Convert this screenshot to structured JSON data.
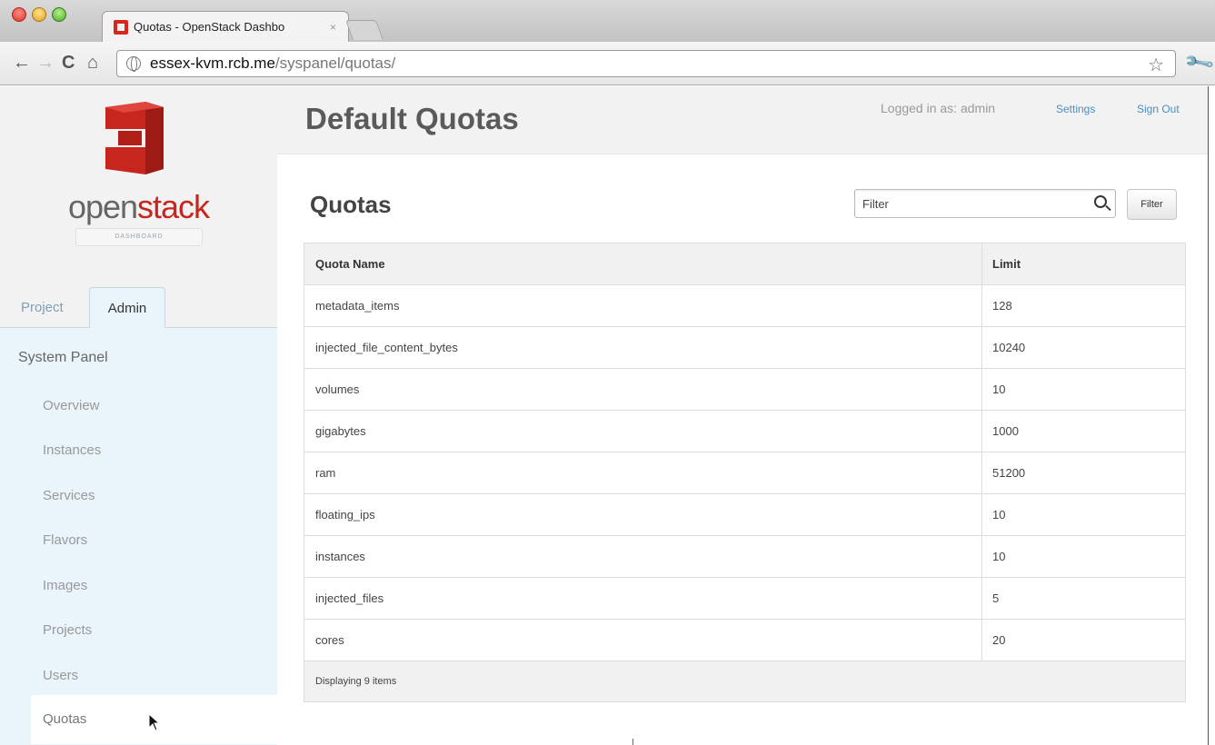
{
  "browser": {
    "tab_title": "Quotas - OpenStack Dashbo",
    "tab_close": "×",
    "url_host": "essex-kvm.rcb.me",
    "url_path": "/syspanel/quotas/",
    "icons": [
      "back-icon",
      "forward-icon",
      "reload-icon",
      "home-icon",
      "globe-icon",
      "star-icon",
      "wrench-icon"
    ]
  },
  "logo": {
    "text_open": "open",
    "text_stack": "stack",
    "subtitle": "DASHBOARD",
    "brand_color": "#c7261e"
  },
  "sidebar": {
    "tabs": [
      {
        "label": "Project",
        "active": false
      },
      {
        "label": "Admin",
        "active": true
      }
    ],
    "panel_title": "System Panel",
    "items": [
      {
        "label": "Overview",
        "active": false
      },
      {
        "label": "Instances",
        "active": false
      },
      {
        "label": "Services",
        "active": false
      },
      {
        "label": "Flavors",
        "active": false
      },
      {
        "label": "Images",
        "active": false
      },
      {
        "label": "Projects",
        "active": false
      },
      {
        "label": "Users",
        "active": false
      },
      {
        "label": "Quotas",
        "active": true
      }
    ]
  },
  "header": {
    "title": "Default Quotas",
    "logged_in": "Logged in as: admin",
    "settings": "Settings",
    "sign_out": "Sign Out",
    "link_color": "#4a8fc1"
  },
  "main": {
    "section_title": "Quotas",
    "filter_placeholder": "Filter",
    "filter_button": "Filter"
  },
  "table": {
    "columns": [
      "Quota Name",
      "Limit"
    ],
    "rows": [
      {
        "name": "metadata_items",
        "limit": "128"
      },
      {
        "name": "injected_file_content_bytes",
        "limit": "10240"
      },
      {
        "name": "volumes",
        "limit": "10"
      },
      {
        "name": "gigabytes",
        "limit": "1000"
      },
      {
        "name": "ram",
        "limit": "51200"
      },
      {
        "name": "floating_ips",
        "limit": "10"
      },
      {
        "name": "instances",
        "limit": "10"
      },
      {
        "name": "injected_files",
        "limit": "5"
      },
      {
        "name": "cores",
        "limit": "20"
      }
    ],
    "footer": "Displaying 9 items"
  }
}
